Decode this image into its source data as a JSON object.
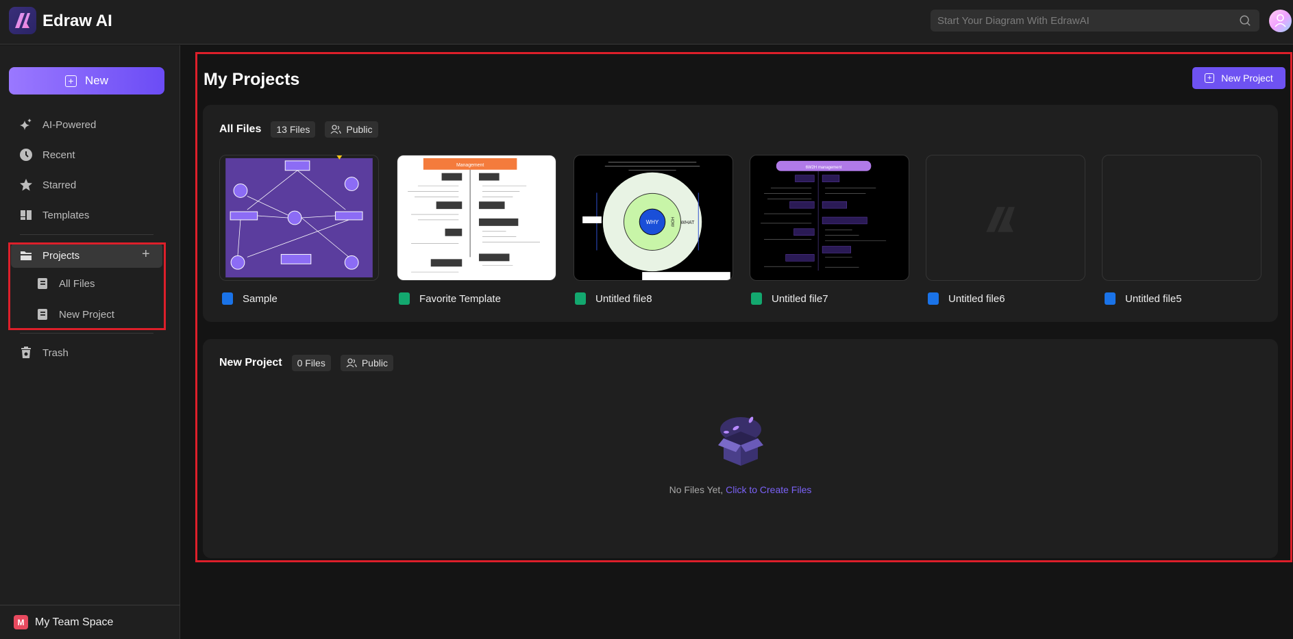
{
  "app": {
    "name": "Edraw AI"
  },
  "search": {
    "placeholder": "Start Your Diagram With EdrawAI"
  },
  "sidebar": {
    "new_label": "New",
    "items": [
      {
        "label": "AI-Powered",
        "icon": "sparkle-icon"
      },
      {
        "label": "Recent",
        "icon": "clock-icon"
      },
      {
        "label": "Starred",
        "icon": "star-icon"
      },
      {
        "label": "Templates",
        "icon": "templates-icon"
      }
    ],
    "projects": {
      "label": "Projects",
      "icon": "folder-icon",
      "children": [
        {
          "label": "All Files"
        },
        {
          "label": "New Project"
        }
      ]
    },
    "trash_label": "Trash",
    "team": {
      "badge": "M",
      "label": "My Team Space"
    }
  },
  "main": {
    "title": "My Projects",
    "new_project_label": "New Project",
    "all_files": {
      "title": "All Files",
      "count": "13 Files",
      "visibility": "Public",
      "files": [
        {
          "name": "Sample",
          "type": "doc",
          "color": "#1a73e8"
        },
        {
          "name": "Favorite Template",
          "type": "mindmap",
          "color": "#13a86f",
          "thumb_title": "Management"
        },
        {
          "name": "Untitled file8",
          "type": "mindmap",
          "color": "#13a86f",
          "thumb_labels": [
            "WHY",
            "HOW",
            "WHAT"
          ]
        },
        {
          "name": "Untitled file7",
          "type": "mindmap",
          "color": "#13a86f",
          "thumb_title": "6W2H management"
        },
        {
          "name": "Untitled file6",
          "type": "doc",
          "color": "#1a73e8"
        },
        {
          "name": "Untitled file5",
          "type": "doc",
          "color": "#1a73e8"
        }
      ]
    },
    "new_project": {
      "title": "New Project",
      "count": "0 Files",
      "visibility": "Public",
      "empty_text": "No Files Yet,",
      "empty_link": "Click to Create Files"
    }
  },
  "colors": {
    "accent": "#6e52f2",
    "annotation": "#dd1f2a"
  }
}
